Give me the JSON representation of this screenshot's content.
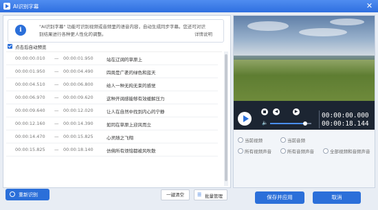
{
  "window": {
    "title": "AI识别字幕",
    "close_glyph": "✕"
  },
  "info": {
    "text": "\"AI识别字幕\" 功能可识别视频或音频里的语音内容，自动生成同步字幕。您还可对识别结果进行各种更人性化的调整。",
    "link": "详情说明"
  },
  "options": {
    "auto_preview_label": "点击后自动预览",
    "auto_preview_checked": true
  },
  "subtitles": [
    {
      "start": "00:00:00.010",
      "dash": "—",
      "end": "00:00:01.950",
      "text": "站在辽阔的草原上"
    },
    {
      "start": "00:00:01.950",
      "dash": "—",
      "end": "00:00:04.490",
      "text": "四周是广袤的绿色和蓝天"
    },
    {
      "start": "00:00:04.510",
      "dash": "—",
      "end": "00:00:06.800",
      "text": "给人一种无拘无束的感觉"
    },
    {
      "start": "00:00:06.970",
      "dash": "—",
      "end": "00:00:09.620",
      "text": "这种开阔感能够有效缓解压力"
    },
    {
      "start": "00:00:09.640",
      "dash": "—",
      "end": "00:00:12.020",
      "text": "让人在自然中找到内心的宁静"
    },
    {
      "start": "00:00:12.160",
      "dash": "—",
      "end": "00:00:14.390",
      "text": "如同在草原上迎风而立"
    },
    {
      "start": "00:00:14.470",
      "dash": "—",
      "end": "00:00:15.825",
      "text": "心灵随之飞翔"
    },
    {
      "start": "00:00:15.825",
      "dash": "—",
      "end": "00:00:18.140",
      "text": "仿佛所有烦恼都被风吹散"
    }
  ],
  "footer_left": {
    "redo_label": "重新识别",
    "clear_label": "一键清空",
    "batch_label": "批量管理"
  },
  "player": {
    "current_time": "00:00:00.000",
    "total_time": "00:00:18.144",
    "volume": 0.85,
    "icons": {
      "play": "play-icon",
      "stop": "stop-icon",
      "prev": "prev-icon",
      "next": "next-icon",
      "volume": "volume-icon"
    }
  },
  "scope": {
    "current_video": "当前视频",
    "current_audio": "当前音频",
    "all_video_audio": "所有视频声音",
    "all_audio": "所有音频声音",
    "all_video_and_audio": "全部视频和音频声音"
  },
  "footer_right": {
    "save_label": "保存并应用",
    "cancel_label": "取消"
  },
  "colors": {
    "accent": "#2b6fd9",
    "titlebar": "#2f6fe0",
    "player_bg": "#1c2532"
  }
}
